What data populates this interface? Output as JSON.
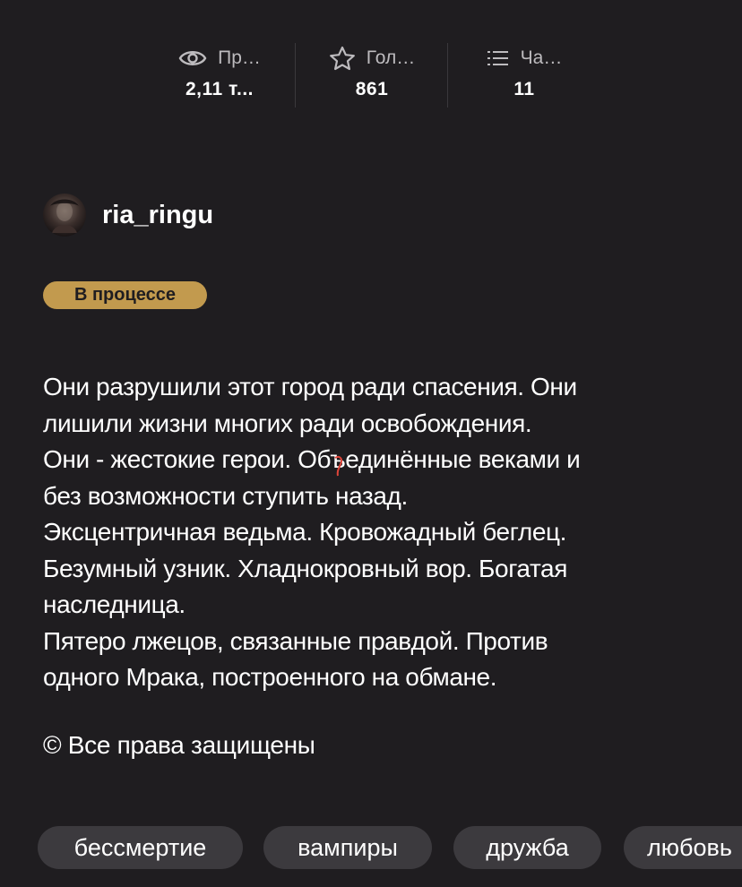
{
  "stats": [
    {
      "label": "Пр…",
      "value": "2,11 т...",
      "icon": "eye-icon"
    },
    {
      "label": "Гол…",
      "value": "861",
      "icon": "star-icon"
    },
    {
      "label": "Ча…",
      "value": "11",
      "icon": "list-icon"
    }
  ],
  "author": {
    "name": "ria_ringu"
  },
  "status": {
    "label": "В процессе",
    "color": "#c29a4e"
  },
  "description": {
    "lines": [
      "Они разрушили этот город ради спасения. Они",
      "лишили жизни многих ради освобождения.",
      "Они - жестокие герои. Объединённые веками и",
      "без возможности ступить назад.",
      "Эксцентричная ведьма. Кровожадный беглец.",
      "Безумный узник. Хладнокровный вор. Богатая",
      "наследница.",
      "Пятеро лжецов, связанные правдой. Против",
      "одного Мрака, построенного на обмане."
    ],
    "copyright": "© Все права защищены"
  },
  "tags": [
    "бессмертие",
    "вампиры",
    "дружба",
    "любовь"
  ],
  "colors": {
    "background": "#1f1d20",
    "tag_background": "#3c3a3e",
    "muted_text": "#bdbbbe"
  }
}
